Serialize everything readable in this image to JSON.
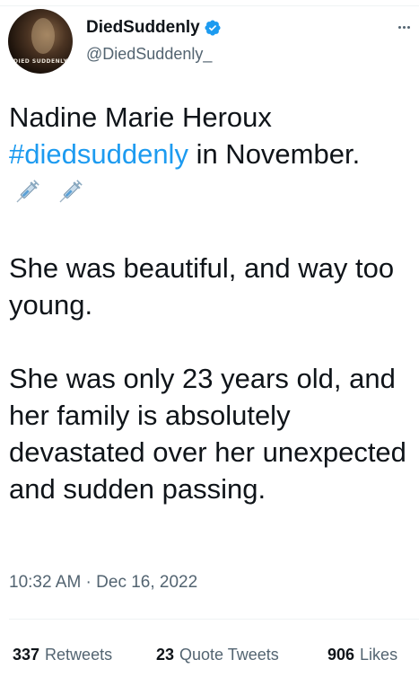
{
  "author": {
    "display_name": "DiedSuddenly",
    "handle": "@DiedSuddenly_",
    "verified": true,
    "avatar_caption": "DIED SUDDENLY"
  },
  "tweet": {
    "line1": "Nadine Marie Heroux",
    "hashtag": "#diedsuddenly",
    "after_hashtag": " in November.",
    "emojis": [
      "syringe-icon",
      "syringe-icon"
    ],
    "para2": "She was beautiful, and way too young.",
    "para3": "She was only 23 years old, and her family is absolutely devastated over her unexpected and sudden passing."
  },
  "timestamp": "10:32 AM · Dec 16, 2022",
  "stats": {
    "retweets_count": "337",
    "retweets_label": "Retweets",
    "quotes_count": "23",
    "quotes_label": "Quote Tweets",
    "likes_count": "906",
    "likes_label": "Likes"
  },
  "colors": {
    "accent": "#1d9bf0",
    "text": "#0f1419",
    "muted": "#536471",
    "divider": "#eff3f4"
  }
}
